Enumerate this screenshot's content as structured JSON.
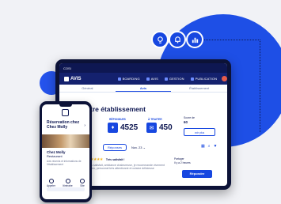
{
  "colors": {
    "accent": "#1747e0",
    "navy": "#0e1752",
    "background": "#f1f2f6"
  },
  "floating_icons": [
    "lightbulb-icon",
    "bell-icon",
    "chart-icon"
  ],
  "tablet": {
    "topbar": {
      "label": "COSI"
    },
    "nav": {
      "logo": "AVIS",
      "menu": [
        "BOARDING",
        "AVIS",
        "GESTION",
        "PUBLICATION"
      ]
    },
    "tabs": [
      "Général",
      "Avis",
      "Établissement"
    ],
    "heading": "tre établissement",
    "stats": [
      {
        "label": "RÉPONDUES",
        "value": "4525",
        "icon": "♦"
      },
      {
        "label": "À TRAITER",
        "value": "450",
        "icon": "✉"
      }
    ],
    "side": {
      "title": "Score de",
      "value": "60",
      "button": "voir plus"
    },
    "filters": {
      "pill": "Réponses",
      "sort": "Nov. 23 ⌄"
    },
    "review": {
      "stars": "★★★★★",
      "title": "Très satisfait !",
      "body": "Très satisfait, ambiance chaleureuse, je recommande vivement ce lieu, personnel très attentionné et cuisine délicieuse",
      "meta": [
        "Partager",
        "Il y a 2 heures"
      ],
      "reply": "Répondre"
    }
  },
  "phone": {
    "title": "Réservation chez Chez Molly",
    "name": "Chez Molly",
    "rating": "Restaurant",
    "sub": "Avis récents et informations de l'établissement",
    "actions": [
      "Appeler",
      "Itinéraire",
      "Site"
    ]
  }
}
